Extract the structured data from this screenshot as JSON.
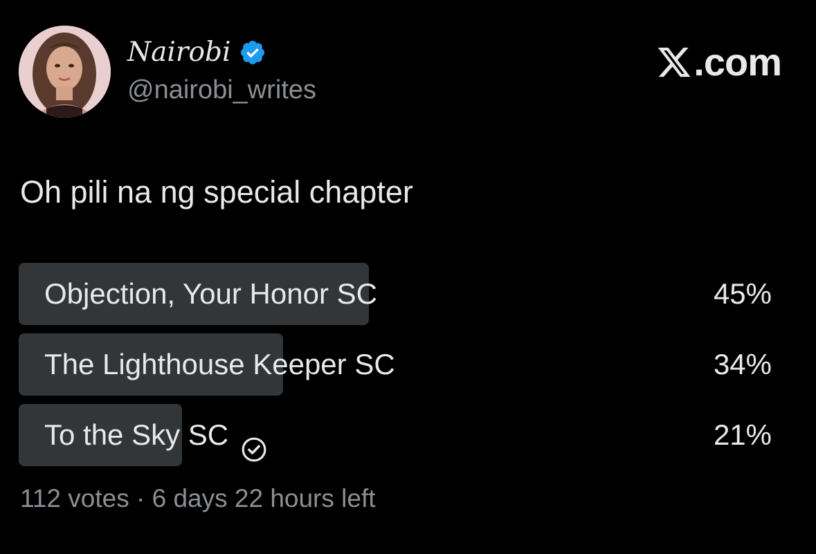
{
  "author": {
    "display_name": "Nairobi",
    "handle": "@nairobi_writes",
    "verified": true,
    "avatar_icon": "profile-photo",
    "verified_color": "#1d9bf0"
  },
  "brand": {
    "label": ".com",
    "logo_icon": "x-logo-icon"
  },
  "tweet": {
    "text": "Oh pili na ng special chapter"
  },
  "poll": {
    "options": [
      {
        "label": "Objection, Your Honor SC",
        "percent_label": "45%",
        "percent": 45,
        "selected": false
      },
      {
        "label": "The Lighthouse Keeper SC",
        "percent_label": "34%",
        "percent": 34,
        "selected": false
      },
      {
        "label": "To the Sky SC",
        "percent_label": "21%",
        "percent": 21,
        "selected": true
      }
    ],
    "votes": "112 votes",
    "separator": "·",
    "time_left": "6 days 22 hours left"
  },
  "colors": {
    "background": "#000000",
    "text": "#e7e9ea",
    "muted": "#8b8f93",
    "poll_bar": "#333639"
  }
}
